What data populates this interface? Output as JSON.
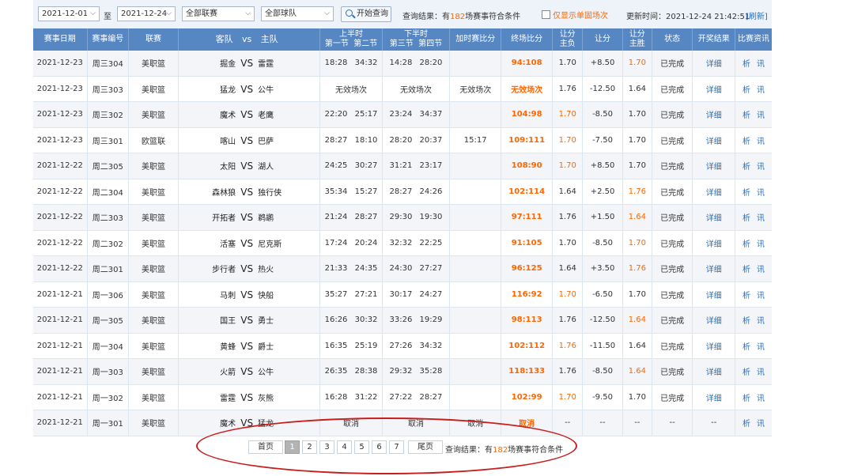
{
  "filter": {
    "date_from": "2021-12-01",
    "to_label": "至",
    "date_to": "2021-12-24",
    "league_select": "全部联赛",
    "team_select": "全部球队",
    "search_button": "开始查询",
    "result_prefix": "查询结果：有",
    "result_count": "182",
    "result_suffix": "场赛事符合条件",
    "only_single_label": "仅显示单固场次",
    "update_label": "更新时间：",
    "update_time": "2021-12-24 21:42:51",
    "refresh_label": "[刷新]"
  },
  "table": {
    "headers": {
      "date": "赛事日期",
      "match_no": "赛事编号",
      "league": "联赛",
      "away_team": "客队",
      "vs": "vs",
      "home_team": "主队",
      "first_half": "上半时",
      "q1": "第一节",
      "q2": "第二节",
      "second_half": "下半时",
      "q3": "第三节",
      "q4": "第四节",
      "ot": "加时赛比分",
      "final": "终场比分",
      "hcap_away_a": "让分",
      "hcap_away_b": "主负",
      "hcap": "让分",
      "hcap_home_a": "让分",
      "hcap_home_b": "主胜",
      "status": "状态",
      "prize": "开奖结果",
      "news": "比赛资讯"
    },
    "rows": [
      {
        "date": "2021-12-23",
        "no": "周三304",
        "league": "美职篮",
        "away": "掘金",
        "vs": "VS",
        "home": "雷霆",
        "q1": "18:28",
        "q2": "34:32",
        "q3": "14:28",
        "q4": "28:20",
        "ot": "",
        "final": "94:108",
        "odds_lose": "1.70",
        "hcap": "+8.50",
        "odds_win": "1.70",
        "win_hl": true,
        "lose_hl": false,
        "status": "已完成",
        "detail": "详细",
        "analysis": "析",
        "news": "讯"
      },
      {
        "date": "2021-12-23",
        "no": "周三303",
        "league": "美职篮",
        "away": "猛龙",
        "vs": "VS",
        "home": "公牛",
        "q1": "无效场次",
        "q2": "",
        "q3": "无效场次",
        "q4": "",
        "ot": "无效场次",
        "final": "无效场次",
        "odds_lose": "1.76",
        "hcap": "-12.50",
        "odds_win": "1.64",
        "win_hl": false,
        "lose_hl": false,
        "status": "已完成",
        "detail": "详细",
        "analysis": "析",
        "news": "讯"
      },
      {
        "date": "2021-12-23",
        "no": "周三302",
        "league": "美职篮",
        "away": "魔术",
        "vs": "VS",
        "home": "老鹰",
        "q1": "22:20",
        "q2": "25:17",
        "q3": "23:24",
        "q4": "34:37",
        "ot": "",
        "final": "104:98",
        "odds_lose": "1.70",
        "hcap": "-8.50",
        "odds_win": "1.70",
        "win_hl": false,
        "lose_hl": true,
        "status": "已完成",
        "detail": "详细",
        "analysis": "析",
        "news": "讯"
      },
      {
        "date": "2021-12-23",
        "no": "周三301",
        "league": "欧篮联",
        "away": "喀山",
        "vs": "VS",
        "home": "巴萨",
        "q1": "28:27",
        "q2": "18:10",
        "q3": "28:20",
        "q4": "20:37",
        "ot": "15:17",
        "final": "109:111",
        "odds_lose": "1.70",
        "hcap": "-7.50",
        "odds_win": "1.70",
        "win_hl": false,
        "lose_hl": true,
        "status": "已完成",
        "detail": "详细",
        "analysis": "析",
        "news": "讯"
      },
      {
        "date": "2021-12-22",
        "no": "周二305",
        "league": "美职篮",
        "away": "太阳",
        "vs": "VS",
        "home": "湖人",
        "q1": "24:25",
        "q2": "30:27",
        "q3": "31:21",
        "q4": "23:17",
        "ot": "",
        "final": "108:90",
        "odds_lose": "1.70",
        "hcap": "+8.50",
        "odds_win": "1.70",
        "win_hl": false,
        "lose_hl": true,
        "status": "已完成",
        "detail": "详细",
        "analysis": "析",
        "news": "讯"
      },
      {
        "date": "2021-12-22",
        "no": "周二304",
        "league": "美职篮",
        "away": "森林狼",
        "vs": "VS",
        "home": "独行侠",
        "q1": "35:34",
        "q2": "15:27",
        "q3": "28:27",
        "q4": "24:26",
        "ot": "",
        "final": "102:114",
        "odds_lose": "1.64",
        "hcap": "+2.50",
        "odds_win": "1.76",
        "win_hl": true,
        "lose_hl": false,
        "status": "已完成",
        "detail": "详细",
        "analysis": "析",
        "news": "讯"
      },
      {
        "date": "2021-12-22",
        "no": "周二303",
        "league": "美职篮",
        "away": "开拓者",
        "vs": "VS",
        "home": "鹈鹕",
        "q1": "21:24",
        "q2": "28:27",
        "q3": "29:30",
        "q4": "19:30",
        "ot": "",
        "final": "97:111",
        "odds_lose": "1.76",
        "hcap": "+1.50",
        "odds_win": "1.64",
        "win_hl": true,
        "lose_hl": false,
        "status": "已完成",
        "detail": "详细",
        "analysis": "析",
        "news": "讯"
      },
      {
        "date": "2021-12-22",
        "no": "周二302",
        "league": "美职篮",
        "away": "活塞",
        "vs": "VS",
        "home": "尼克斯",
        "q1": "17:24",
        "q2": "20:24",
        "q3": "32:32",
        "q4": "22:25",
        "ot": "",
        "final": "91:105",
        "odds_lose": "1.70",
        "hcap": "-8.50",
        "odds_win": "1.70",
        "win_hl": true,
        "lose_hl": false,
        "status": "已完成",
        "detail": "详细",
        "analysis": "析",
        "news": "讯"
      },
      {
        "date": "2021-12-22",
        "no": "周二301",
        "league": "美职篮",
        "away": "步行者",
        "vs": "VS",
        "home": "热火",
        "q1": "21:33",
        "q2": "24:35",
        "q3": "24:30",
        "q4": "27:27",
        "ot": "",
        "final": "96:125",
        "odds_lose": "1.64",
        "hcap": "+3.50",
        "odds_win": "1.76",
        "win_hl": true,
        "lose_hl": false,
        "status": "已完成",
        "detail": "详细",
        "analysis": "析",
        "news": "讯"
      },
      {
        "date": "2021-12-21",
        "no": "周一306",
        "league": "美职篮",
        "away": "马刺",
        "vs": "VS",
        "home": "快船",
        "q1": "35:27",
        "q2": "27:21",
        "q3": "30:17",
        "q4": "24:27",
        "ot": "",
        "final": "116:92",
        "odds_lose": "1.70",
        "hcap": "-6.50",
        "odds_win": "1.70",
        "win_hl": false,
        "lose_hl": true,
        "status": "已完成",
        "detail": "详细",
        "analysis": "析",
        "news": "讯"
      },
      {
        "date": "2021-12-21",
        "no": "周一305",
        "league": "美职篮",
        "away": "国王",
        "vs": "VS",
        "home": "勇士",
        "q1": "16:26",
        "q2": "30:32",
        "q3": "33:26",
        "q4": "19:29",
        "ot": "",
        "final": "98:113",
        "odds_lose": "1.76",
        "hcap": "-12.50",
        "odds_win": "1.64",
        "win_hl": true,
        "lose_hl": false,
        "status": "已完成",
        "detail": "详细",
        "analysis": "析",
        "news": "讯"
      },
      {
        "date": "2021-12-21",
        "no": "周一304",
        "league": "美职篮",
        "away": "黄蜂",
        "vs": "VS",
        "home": "爵士",
        "q1": "16:35",
        "q2": "25:19",
        "q3": "27:26",
        "q4": "34:32",
        "ot": "",
        "final": "102:112",
        "odds_lose": "1.76",
        "hcap": "-11.50",
        "odds_win": "1.64",
        "win_hl": false,
        "lose_hl": true,
        "status": "已完成",
        "detail": "详细",
        "analysis": "析",
        "news": "讯"
      },
      {
        "date": "2021-12-21",
        "no": "周一303",
        "league": "美职篮",
        "away": "火箭",
        "vs": "VS",
        "home": "公牛",
        "q1": "26:35",
        "q2": "28:38",
        "q3": "29:32",
        "q4": "35:28",
        "ot": "",
        "final": "118:133",
        "odds_lose": "1.76",
        "hcap": "-8.50",
        "odds_win": "1.64",
        "win_hl": true,
        "lose_hl": false,
        "status": "已完成",
        "detail": "详细",
        "analysis": "析",
        "news": "讯"
      },
      {
        "date": "2021-12-21",
        "no": "周一302",
        "league": "美职篮",
        "away": "雷霆",
        "vs": "VS",
        "home": "灰熊",
        "q1": "16:28",
        "q2": "31:22",
        "q3": "27:22",
        "q4": "28:27",
        "ot": "",
        "final": "102:99",
        "odds_lose": "1.70",
        "hcap": "-9.50",
        "odds_win": "1.70",
        "win_hl": false,
        "lose_hl": true,
        "status": "已完成",
        "detail": "详细",
        "analysis": "析",
        "news": "讯"
      },
      {
        "date": "2021-12-21",
        "no": "周一301",
        "league": "美职篮",
        "away": "魔术",
        "vs": "VS",
        "home": "猛龙",
        "q1": "取消",
        "q2": "",
        "q3": "取消",
        "q4": "",
        "ot": "取消",
        "final": "取消",
        "odds_lose": "--",
        "hcap": "--",
        "odds_win": "--",
        "win_hl": false,
        "lose_hl": false,
        "status": "--",
        "detail": "--",
        "analysis": "析",
        "news": "讯"
      }
    ]
  },
  "pager": {
    "first": "首页",
    "pages": [
      "1",
      "2",
      "3",
      "4",
      "5",
      "6",
      "7"
    ],
    "active_page": "1",
    "last": "尾页",
    "result_prefix": "查询结果：有",
    "result_count": "182",
    "result_suffix": "场赛事符合条件"
  },
  "colors": {
    "header_bg": "#5687c3",
    "highlight": "#ff6600",
    "link": "#2a6fba",
    "annotation": "#c81e1e"
  }
}
